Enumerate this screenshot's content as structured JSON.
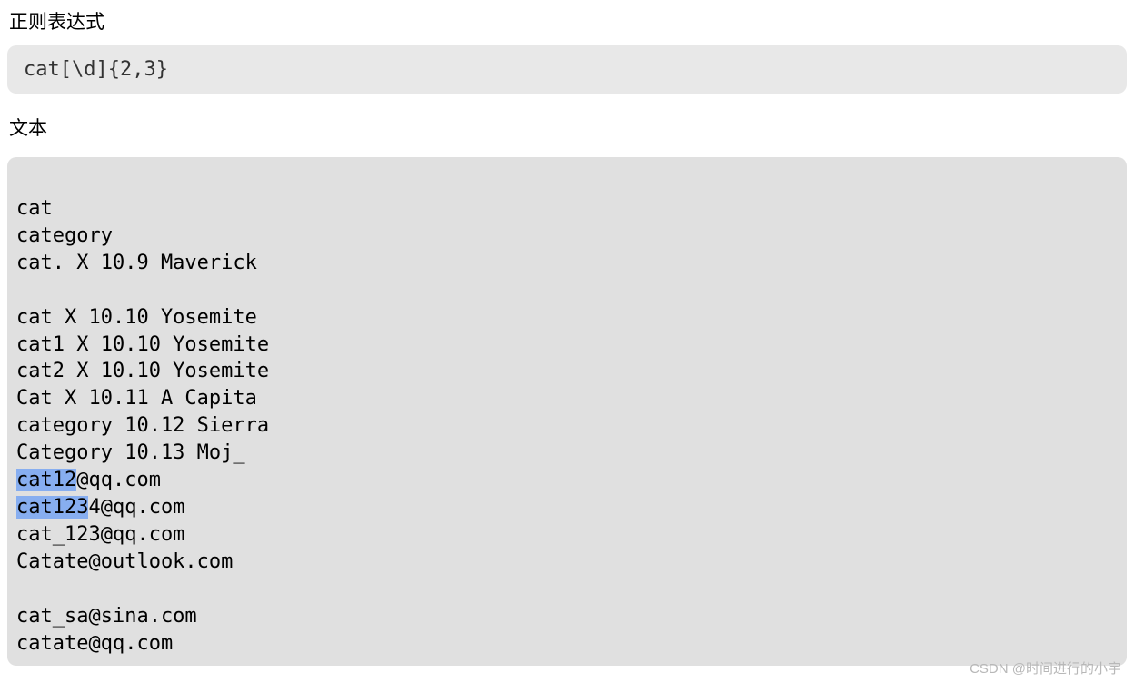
{
  "labels": {
    "regex_section": "正则表达式",
    "text_section": "文本"
  },
  "regex": {
    "pattern": "cat[\\d]{2,3}"
  },
  "text_content": {
    "lines": [
      {
        "segments": [
          {
            "text": "cat",
            "hl": false
          }
        ]
      },
      {
        "segments": [
          {
            "text": "category",
            "hl": false
          }
        ]
      },
      {
        "segments": [
          {
            "text": "cat. X 10.9 Maverick",
            "hl": false
          }
        ]
      },
      {
        "segments": [
          {
            "text": "",
            "hl": false
          }
        ]
      },
      {
        "segments": [
          {
            "text": "cat X 10.10 Yosemite",
            "hl": false
          }
        ]
      },
      {
        "segments": [
          {
            "text": "cat1 X 10.10 Yosemite",
            "hl": false
          }
        ]
      },
      {
        "segments": [
          {
            "text": "cat2 X 10.10 Yosemite",
            "hl": false
          }
        ]
      },
      {
        "segments": [
          {
            "text": "Cat X 10.11 A Capita",
            "hl": false
          }
        ]
      },
      {
        "segments": [
          {
            "text": "category 10.12 Sierra",
            "hl": false
          }
        ]
      },
      {
        "segments": [
          {
            "text": "Category 10.13 Moj_",
            "hl": false
          }
        ]
      },
      {
        "segments": [
          {
            "text": "cat12",
            "hl": true
          },
          {
            "text": "@qq.com",
            "hl": false
          }
        ]
      },
      {
        "segments": [
          {
            "text": "cat123",
            "hl": true
          },
          {
            "text": "4@qq.com",
            "hl": false
          }
        ]
      },
      {
        "segments": [
          {
            "text": "cat_123@qq.com",
            "hl": false
          }
        ]
      },
      {
        "segments": [
          {
            "text": "Catate@outlook.com",
            "hl": false
          }
        ]
      },
      {
        "segments": [
          {
            "text": "",
            "hl": false
          }
        ]
      },
      {
        "segments": [
          {
            "text": "cat_sa@sina.com",
            "hl": false
          }
        ]
      },
      {
        "segments": [
          {
            "text": "catate@qq.com",
            "hl": false
          }
        ]
      }
    ]
  },
  "watermark": "CSDN @时间进行的小宇"
}
